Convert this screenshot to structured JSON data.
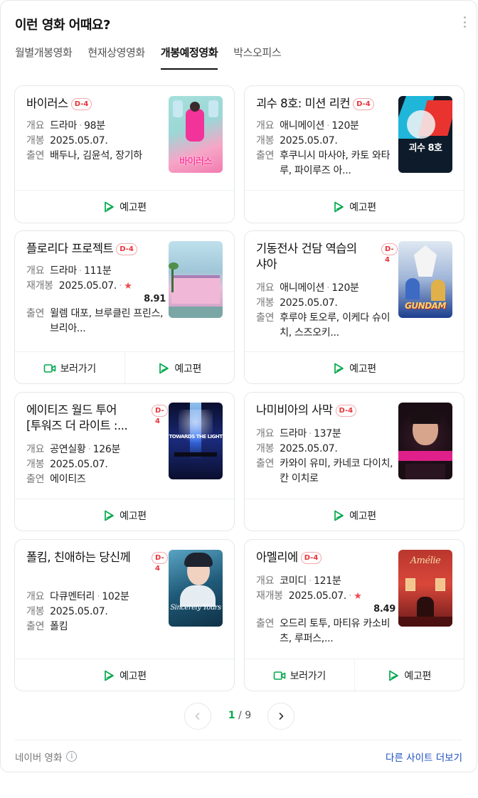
{
  "header": {
    "title": "이런 영화 어때요?"
  },
  "tabs": [
    {
      "label": "월별개봉영화"
    },
    {
      "label": "현재상영영화"
    },
    {
      "label": "개봉예정영화"
    },
    {
      "label": "박스오피스"
    }
  ],
  "labels": {
    "genre": "개요",
    "release": "개봉",
    "rerelease": "재개봉",
    "cast": "출연",
    "watch": "보러가기",
    "trailer": "예고편",
    "dot": "·",
    "star": "★"
  },
  "movies": [
    {
      "title": "바이러스",
      "dday": "D-4",
      "genre": "드라마",
      "runtime": "98분",
      "date": "2025.05.07.",
      "cast": "배두나, 김윤석, 장기하",
      "poster_text": "바이러스",
      "poster_colors": [
        "#9bd7d6",
        "#f27bb0"
      ]
    },
    {
      "title": "괴수 8호: 미션 리컨",
      "dday": "D-4",
      "genre": "애니메이션",
      "runtime": "120분",
      "date": "2025.05.07.",
      "cast": "후쿠니시 마사야, 카토 와타루, 파이루즈 아...",
      "poster_text": "괴수 8호",
      "poster_colors": [
        "#0d1b2a",
        "#1fb6d9"
      ]
    },
    {
      "title": "플로리다 프로젝트",
      "dday": "D-4",
      "genre": "드라마",
      "runtime": "111분",
      "date": "2025.05.07.",
      "score": "8.91",
      "cast": "윌렘 대포, 브루클린 프린스, 브리아...",
      "poster_colors": [
        "#9fc6d8",
        "#c99ac2"
      ]
    },
    {
      "title": "기동전사 건담 역습의 샤아",
      "dday": "D-4",
      "genre": "애니메이션",
      "runtime": "120분",
      "date": "2025.05.07.",
      "cast": "후루야 토오루, 이케다 슈이치, 스즈오키...",
      "poster_text": "GUNDAM",
      "poster_colors": [
        "#1d3f8f",
        "#f0c84a"
      ]
    },
    {
      "title": "에이티즈 월드 투어 [투워즈 더 라이트 :...",
      "dday": "D-4",
      "genre": "공연실황",
      "runtime": "126분",
      "date": "2025.05.07.",
      "cast": "에이티즈",
      "poster_text": "TOWARDS THE LIGHT",
      "poster_colors": [
        "#0a0f2e",
        "#3e7dff"
      ]
    },
    {
      "title": "나미비아의 사막",
      "dday": "D-4",
      "genre": "드라마",
      "runtime": "137분",
      "date": "2025.05.07.",
      "cast": "카와이 유미, 카네코 다이치, 칸 이치로",
      "poster_colors": [
        "#1a0d14",
        "#e0208a"
      ]
    },
    {
      "title": "폴킴, 친애하는 당신께",
      "dday": "D-4",
      "genre": "다큐멘터리",
      "runtime": "102분",
      "date": "2025.05.07.",
      "cast": "폴킴",
      "poster_text": "Sincerely Yours",
      "poster_colors": [
        "#0f3146",
        "#5aa4c4"
      ]
    },
    {
      "title": "아멜리에",
      "dday": "D-4",
      "genre": "코미디",
      "runtime": "121분",
      "date": "2025.05.07.",
      "score": "8.49",
      "cast": "오드리 토투, 마티유 카소비츠, 루퍼스,...",
      "poster_text": "Amélie",
      "poster_colors": [
        "#6a1a1a",
        "#d9473a"
      ]
    }
  ],
  "pagination": {
    "current": "1",
    "separator": "/",
    "total": "9"
  },
  "footer": {
    "source": "네이버 영화",
    "info_glyph": "i",
    "more_link": "다른 사이트 더보기"
  },
  "colors": {
    "accent": "#03a94d",
    "dday": "#e8333a",
    "link": "#1e4fc0"
  }
}
